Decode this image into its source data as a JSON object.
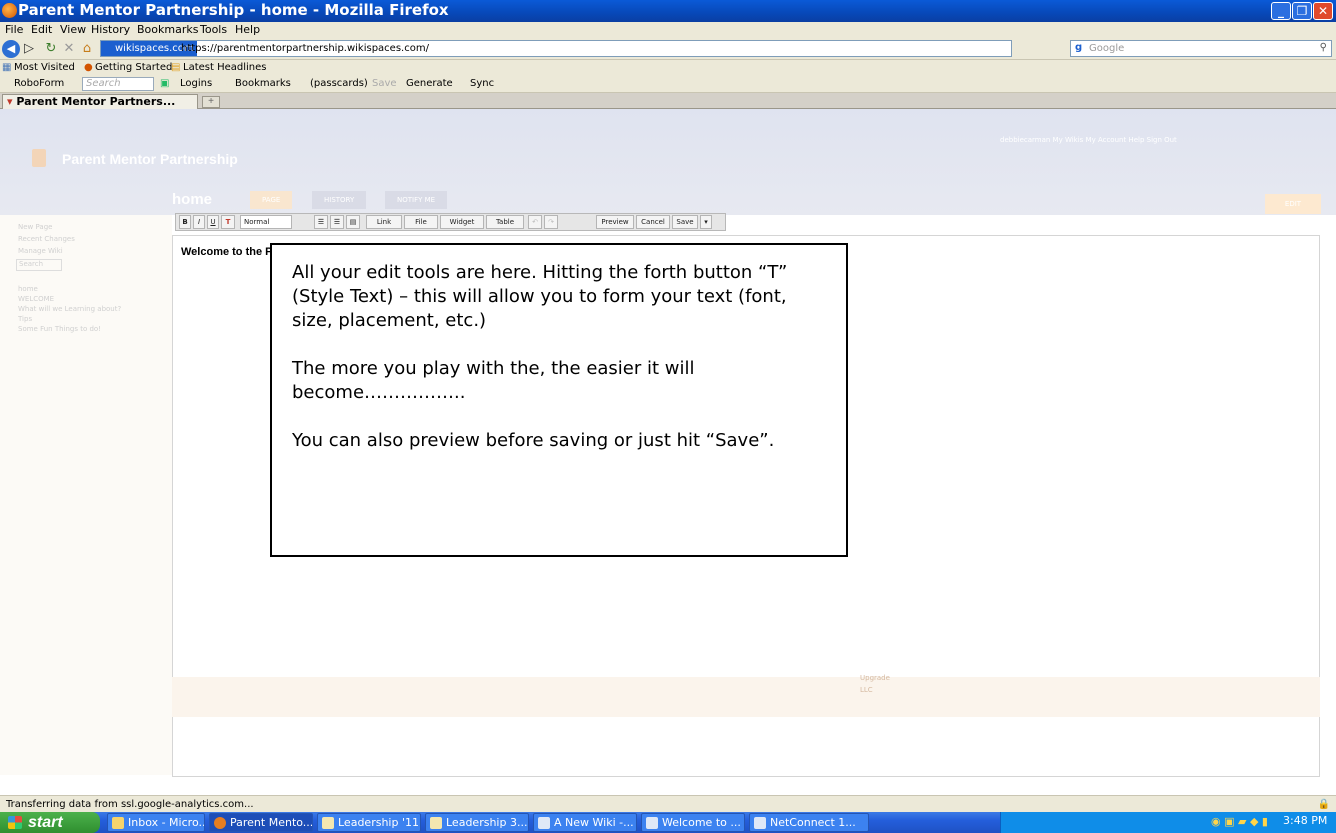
{
  "window": {
    "title": "Parent Mentor Partnership - home - Mozilla Firefox"
  },
  "menu": [
    "File",
    "Edit",
    "View",
    "History",
    "Bookmarks",
    "Tools",
    "Help"
  ],
  "nav": {
    "domain": "wikispaces.com",
    "url": "https://parentmentorpartnership.wikispaces.com/",
    "search_placeholder": "Google"
  },
  "bookmarks": [
    "Most Visited",
    "Getting Started",
    "Latest Headlines"
  ],
  "roboform": {
    "label": "RoboForm",
    "search": "Search",
    "logins": "Logins",
    "bookmarks": "Bookmarks",
    "passcards": "(passcards)",
    "save": "Save",
    "generate": "Generate",
    "sync": "Sync"
  },
  "tab": {
    "label": "Parent Mentor Partners..."
  },
  "wiki": {
    "title": "Parent Mentor Partnership",
    "toplinks": "debbiecarman  My Wikis  My Account  Help  Sign Out",
    "page_name": "home",
    "tabs": [
      "PAGE",
      "HISTORY",
      "NOTIFY ME"
    ],
    "edit": "EDIT",
    "sidebar": [
      "New Page",
      "Recent Changes",
      "Manage Wiki",
      "Search",
      "home",
      "WELCOME",
      "What will we Learning about?",
      "Tips",
      "Some Fun Things to do!"
    ],
    "toolbar": {
      "style": "Normal",
      "link": "Link",
      "file": "File",
      "widget": "Widget",
      "table": "Table",
      "preview": "Preview",
      "cancel": "Cancel",
      "save": "Save"
    },
    "welcome": "Welcome to the Parent Mentor Partnership Training Wiki",
    "footer": [
      "Upgrade",
      "LLC"
    ]
  },
  "callout": {
    "p1": "All your edit tools are here.  Hitting the forth button “T” (Style Text) – this will allow you to form your text (font, size, placement, etc.)",
    "p2": "The more you play with the, the easier it will become……………..",
    "p3": "You can also preview before saving or just hit “Save”."
  },
  "status": "Transferring data from ssl.google-analytics.com...",
  "taskbar": {
    "start": "start",
    "tasks": [
      "Inbox - Micro...",
      "Parent Mento...",
      "Leadership '11",
      "Leadership 3....",
      "A New Wiki -...",
      "Welcome to ...",
      "NetConnect 1..."
    ],
    "clock": "3:48 PM"
  },
  "colors": {
    "titlebar": "#0848b8",
    "taskbar": "#245edb",
    "start": "#2f8f2f",
    "wiki_header": "#dfe3f0"
  }
}
